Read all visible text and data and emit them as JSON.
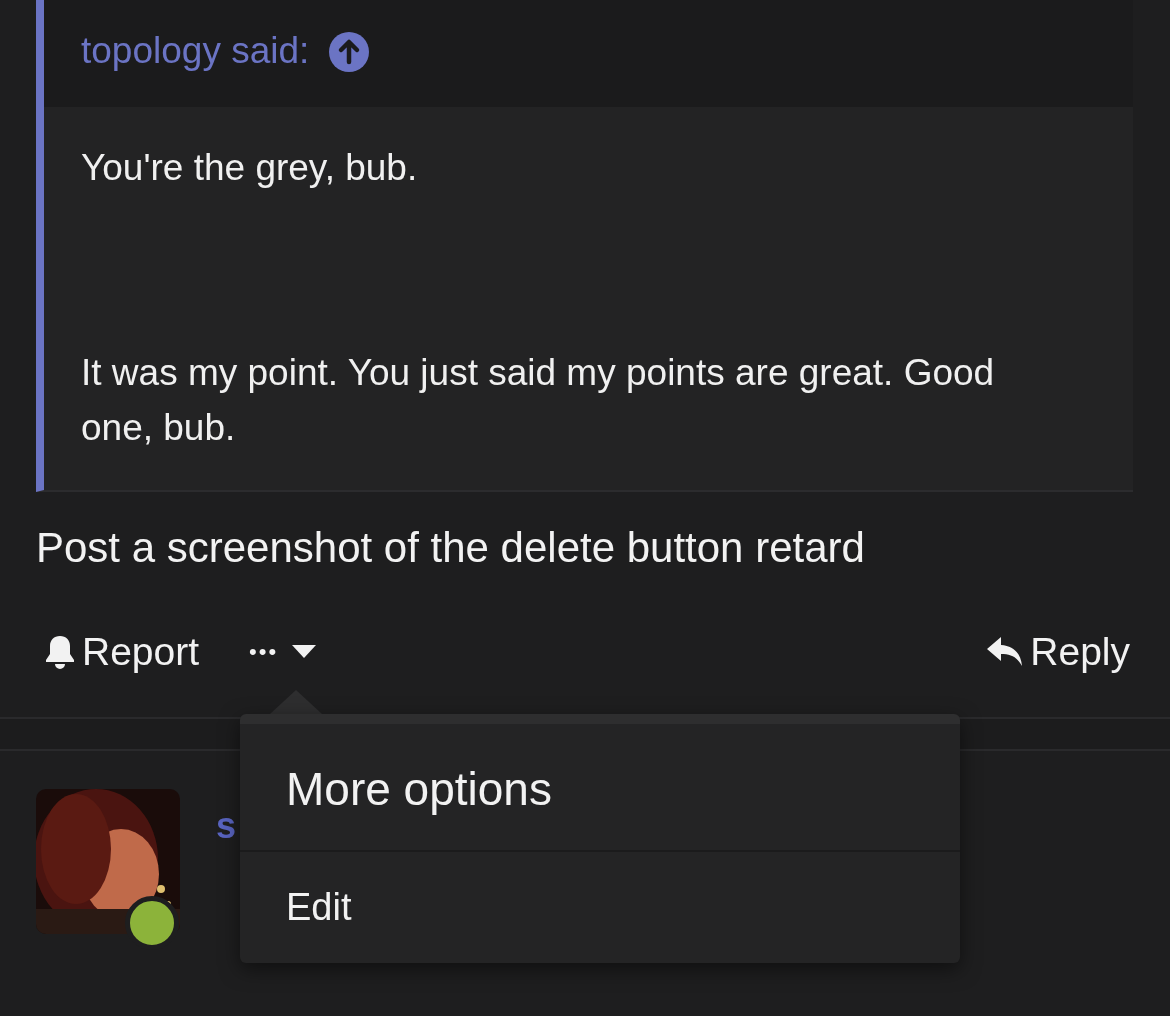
{
  "quote": {
    "author": "topology said:",
    "paragraphs": [
      "You're the grey, bub.",
      "It was my point. You just said my points are great. Good one, bub."
    ]
  },
  "post": {
    "text": "Post a screenshot of the delete button retard"
  },
  "actions": {
    "report": "Report",
    "more": "•••",
    "reply": "Reply"
  },
  "menu": {
    "expanded": true,
    "title": "More options",
    "items": [
      "Edit"
    ]
  },
  "next_post": {
    "username": "s",
    "online": true
  }
}
